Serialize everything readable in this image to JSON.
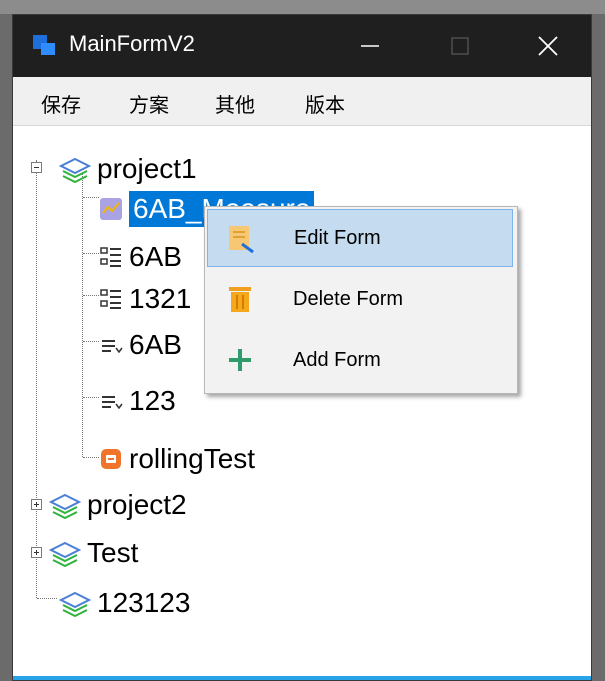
{
  "window": {
    "title": "MainFormV2",
    "controls": {
      "minimize": "—",
      "maximize": "☐",
      "close": "✕"
    }
  },
  "menu": [
    "保存",
    "方案",
    "其他",
    "版本"
  ],
  "tree": {
    "project1": {
      "label": "project1",
      "children": [
        "6AB_Measure",
        "6AB",
        "1321",
        "6AB",
        "123",
        "rollingTest"
      ]
    },
    "project2": "project2",
    "test": "Test",
    "p123123": "123123"
  },
  "context_menu": {
    "edit": "Edit Form",
    "delete": "Delete Form",
    "add": "Add Form"
  },
  "colors": {
    "selection": "#0078d7",
    "menu_highlight": "#c5dcf0",
    "layer_icon_blue": "#4a7fd6",
    "layer_icon_green": "#2fb33c",
    "accent": "#29a3e8"
  }
}
